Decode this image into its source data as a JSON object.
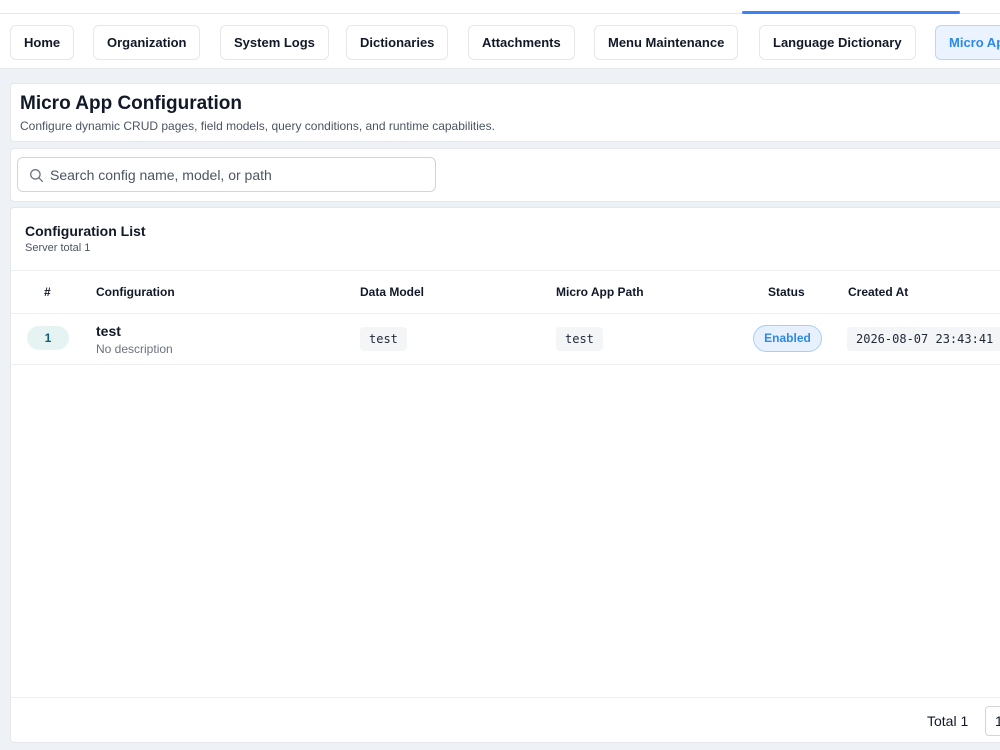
{
  "tabs": [
    {
      "label": "Home",
      "active": false
    },
    {
      "label": "Organization",
      "active": false
    },
    {
      "label": "System Logs",
      "active": false
    },
    {
      "label": "Dictionaries",
      "active": false
    },
    {
      "label": "Attachments",
      "active": false
    },
    {
      "label": "Menu Maintenance",
      "active": false
    },
    {
      "label": "Language Dictionary",
      "active": false
    },
    {
      "label": "Micro App Configuration",
      "active": true
    }
  ],
  "header": {
    "title": "Micro App Configuration",
    "subtitle": "Configure dynamic CRUD pages, field models, query conditions, and runtime capabilities."
  },
  "search": {
    "icon": "search-icon",
    "placeholder": "Search config name, model, or path",
    "value": ""
  },
  "list": {
    "title": "Configuration List",
    "subtitle": "Server total 1",
    "columns": {
      "index": "#",
      "configuration": "Configuration",
      "data_model": "Data Model",
      "path": "Micro App Path",
      "status": "Status",
      "created_at": "Created At"
    },
    "rows": [
      {
        "index": "1",
        "name": "test",
        "description": "No description",
        "data_model": "test",
        "path": "test",
        "status": "Enabled",
        "created_at": "2026-08-07 23:43:41"
      }
    ]
  },
  "footer": {
    "total_label": "Total 1",
    "page_size": "1"
  },
  "colors": {
    "accent": "#2d8ae8",
    "active_tab_bg": "#eaf3ff",
    "index_badge_bg": "#e6f3f3"
  }
}
